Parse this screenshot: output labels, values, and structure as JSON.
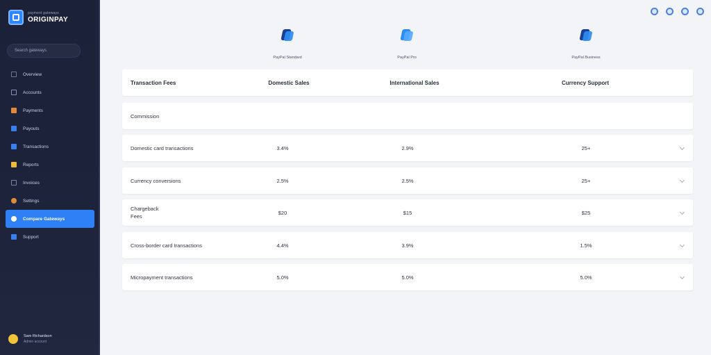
{
  "sidebar": {
    "brand_sub": "payment gateways",
    "brand_name": "ORIGINPAY",
    "search_placeholder": "Search gateways",
    "items": [
      {
        "label": "Overview",
        "icon": "grid-icon",
        "color": "#6f7794"
      },
      {
        "label": "Accounts",
        "icon": "users-icon",
        "color": "#8a93b3"
      },
      {
        "label": "Payments",
        "icon": "card-icon",
        "color": "#e08a3a"
      },
      {
        "label": "Payouts",
        "icon": "wallet-icon",
        "color": "#3a7ff0"
      },
      {
        "label": "Transactions",
        "icon": "list-icon",
        "color": "#3a7ff0"
      },
      {
        "label": "Reports",
        "icon": "chart-icon",
        "color": "#f0b93a"
      },
      {
        "label": "Invoices",
        "icon": "document-icon",
        "color": "#7f86a3"
      },
      {
        "label": "Settings",
        "icon": "gear-icon",
        "color": "#e08a3a"
      },
      {
        "label": "Compare Gateways",
        "icon": "compare-icon",
        "color": "#ffffff",
        "active": true
      },
      {
        "label": "Support",
        "icon": "help-icon",
        "color": "#3a7ff0"
      }
    ]
  },
  "user": {
    "name": "Sam Richardson",
    "sub": "Admin account"
  },
  "top_icons": [
    "bell-icon",
    "settings-icon",
    "help-icon",
    "profile-icon"
  ],
  "providers": [
    {
      "name": "PayPal Standard"
    },
    {
      "name": "PayPal Pro"
    },
    {
      "name": "PayPal Business"
    }
  ],
  "table": {
    "header": {
      "label": "Transaction Fees",
      "cols": [
        "Domestic Sales",
        "International Sales",
        "Currency Support"
      ]
    },
    "section": "Commission",
    "rows": [
      {
        "label": "Domestic card transactions",
        "values": [
          "3.4%",
          "2.9%",
          "25+"
        ]
      },
      {
        "label": "Currency conversions",
        "values": [
          "2.5%",
          "2.5%",
          "25+"
        ]
      },
      {
        "label_lines": [
          "Chargeback",
          "Fees"
        ],
        "values": [
          "$20",
          "$15",
          "$25"
        ]
      },
      {
        "label": "Cross-border card transactions",
        "values": [
          "4.4%",
          "3.9%",
          "1.5%"
        ]
      },
      {
        "label": "Micropayment transactions",
        "values": [
          "5.0%",
          "5.0%",
          "5.0%"
        ]
      }
    ]
  },
  "colors": {
    "accent": "#2f7ff5",
    "sidebar_bg": "#1b2137",
    "page_bg": "#f3f4f8"
  }
}
